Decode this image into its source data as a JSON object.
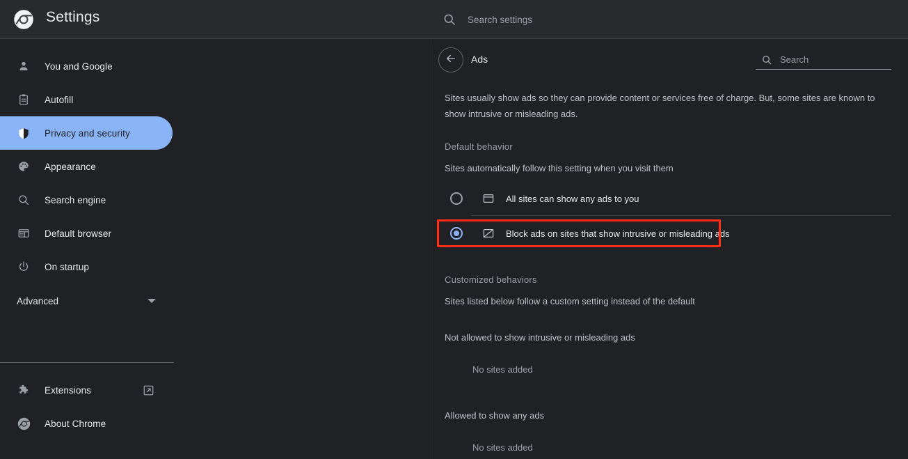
{
  "window": {
    "background": "#202124",
    "accent": "#8ab4f8",
    "highlight_color": "#ff2d16"
  },
  "topbar": {
    "logo_icon": "chrome-logo-icon",
    "title": "Settings",
    "search": {
      "icon": "search-icon",
      "placeholder": "Search settings",
      "value": ""
    }
  },
  "sidebar": {
    "items": [
      {
        "label": "You and Google",
        "icon": "person-icon",
        "active": false
      },
      {
        "label": "Autofill",
        "icon": "clipboard-icon",
        "active": false
      },
      {
        "label": "Privacy and security",
        "icon": "shield-icon",
        "active": true
      },
      {
        "label": "Appearance",
        "icon": "palette-icon",
        "active": false
      },
      {
        "label": "Search engine",
        "icon": "search-icon",
        "active": false
      },
      {
        "label": "Default browser",
        "icon": "browser-window-icon",
        "active": false
      },
      {
        "label": "On startup",
        "icon": "power-icon",
        "active": false
      }
    ],
    "advanced": {
      "label": "Advanced",
      "chevron_icon": "chevron-down-icon"
    },
    "footer_items": [
      {
        "label": "Extensions",
        "icon": "puzzle-piece-icon",
        "trailing_icon": "open-in-new-icon"
      },
      {
        "label": "About Chrome",
        "icon": "chrome-logo-icon",
        "trailing_icon": ""
      }
    ]
  },
  "main": {
    "back_icon": "back-arrow-icon",
    "title": "Ads",
    "search": {
      "icon": "search-icon",
      "placeholder": "Search",
      "value": ""
    },
    "description": "Sites usually show ads so they can provide content or services free of charge. But, some sites are known to show intrusive or misleading ads.",
    "default_behavior": {
      "heading": "Default behavior",
      "subtitle": "Sites automatically follow this setting when you visit them",
      "options": [
        {
          "label": "All sites can show any ads to you",
          "icon": "ad-window-icon",
          "selected": false,
          "highlighted": false
        },
        {
          "label": "Block ads on sites that show intrusive or misleading ads",
          "icon": "ad-blocked-icon",
          "selected": true,
          "highlighted": true
        }
      ]
    },
    "customized_behaviors": {
      "heading": "Customized behaviors",
      "subtitle": "Sites listed below follow a custom setting instead of the default",
      "groups": [
        {
          "label": "Not allowed to show intrusive or misleading ads",
          "empty_text": "No sites added"
        },
        {
          "label": "Allowed to show any ads",
          "empty_text": "No sites added"
        }
      ]
    }
  }
}
